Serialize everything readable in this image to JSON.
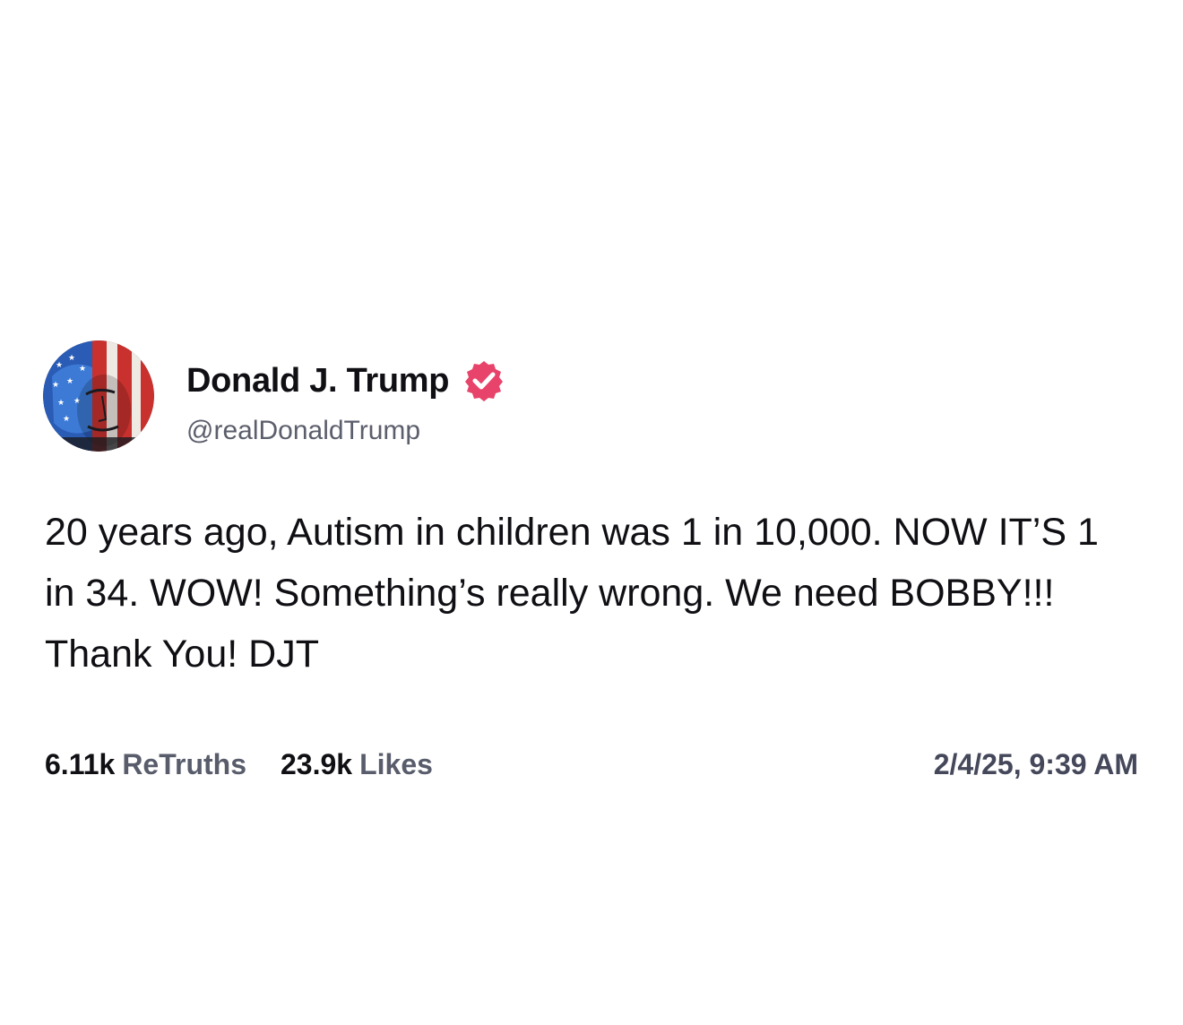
{
  "author": {
    "display_name": "Donald J. Trump",
    "handle": "@realDonaldTrump",
    "avatar_icon": "flag-portrait-avatar",
    "verified_icon": "verified-badge-icon",
    "verified_color": "#e8436a"
  },
  "post": {
    "text": "20 years ago, Autism in children was 1 in 10,000. NOW IT’S 1 in 34. WOW! Something’s really wrong. We need BOBBY!!! Thank You! DJT"
  },
  "stats": {
    "retruths_count": "6.11k",
    "retruths_label": "ReTruths",
    "likes_count": "23.9k",
    "likes_label": "Likes",
    "timestamp": "2/4/25, 9:39 AM"
  },
  "colors": {
    "text_primary": "#0f0f14",
    "text_secondary": "#5b5e6b",
    "background": "#ffffff"
  }
}
